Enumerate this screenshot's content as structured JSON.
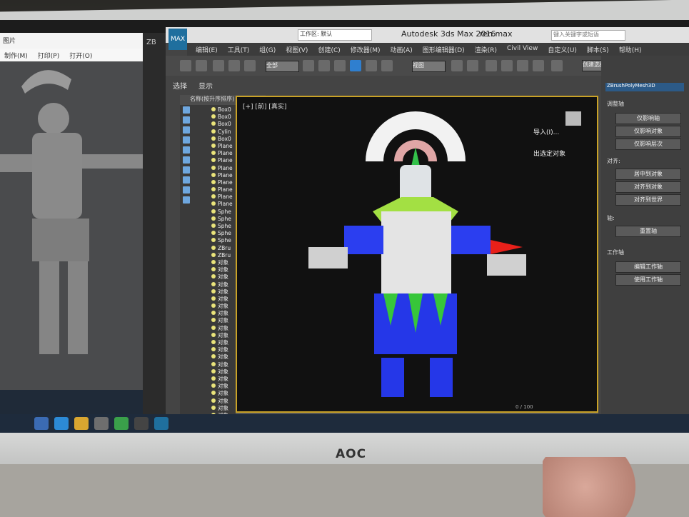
{
  "monitor": {
    "brand": "AOC"
  },
  "viewer": {
    "title": "图片",
    "menu": [
      "制作(M)",
      "打印(P)",
      "打开(O)"
    ]
  },
  "zbrush": {
    "label": "ZB"
  },
  "max": {
    "app_title": "Autodesk 3ds Max 2016",
    "file_name": "ren.max",
    "workspace": "工作区: 默认",
    "search_placeholder": "键入关键字或短语",
    "logo": "MAX",
    "menu": [
      "编辑(E)",
      "工具(T)",
      "组(G)",
      "视图(V)",
      "创建(C)",
      "修改器(M)",
      "动画(A)",
      "图形编辑器(D)",
      "渲染(R)",
      "Civil View",
      "自定义(U)",
      "脚本(S)",
      "帮助(H)"
    ],
    "selection_filter": "全部",
    "snap_dropdown": "视图",
    "named_selection": "创建选择集",
    "scene_tabs": [
      "选择",
      "显示"
    ],
    "explorer": {
      "header": "名称(按升序排序)",
      "rows": [
        "Box0",
        "Box0",
        "Box0",
        "Cylin",
        "Box0",
        "Plane",
        "Plane",
        "Plane",
        "Plane",
        "Plane",
        "Plane",
        "Plane",
        "Plane",
        "Plane",
        "Sphe",
        "Sphe",
        "Sphe",
        "Sphe",
        "Sphe",
        "ZBru",
        "ZBru",
        "对象",
        "对象",
        "对象",
        "对象",
        "对象",
        "对象",
        "对象",
        "对象",
        "对象",
        "对象",
        "对象",
        "对象",
        "对象",
        "对象",
        "对象",
        "对象",
        "对象",
        "对象",
        "对象",
        "对象",
        "对象",
        "对象"
      ]
    },
    "viewport": {
      "label": "[+] [前] [真实]",
      "frame_counter": "0 / 100"
    },
    "command_panel": {
      "title": "ZBrushPolyMesh3D",
      "import_label": "导入(I)...",
      "detach_label": "出选定对象",
      "groups": [
        {
          "head": "调整轴",
          "buttons": [
            "仅影响轴",
            "仅影响对象",
            "仅影响层次"
          ]
        },
        {
          "head": "对齐:",
          "buttons": [
            "居中到对象",
            "对齐到对象",
            "对齐到世界"
          ]
        },
        {
          "head": "轴:",
          "buttons": [
            "重置轴"
          ]
        },
        {
          "head": "工作轴",
          "buttons": [
            "编辑工作轴",
            "使用工作轴"
          ]
        }
      ]
    }
  }
}
